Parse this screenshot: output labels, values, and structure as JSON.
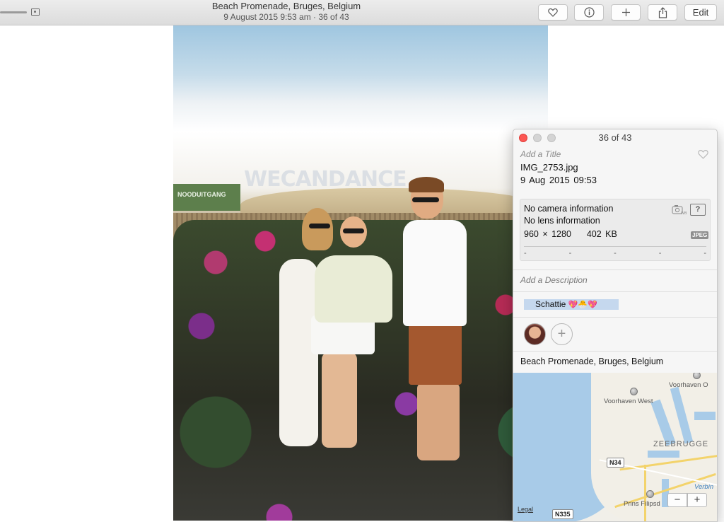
{
  "toolbar": {
    "title": "Beach Promenade, Bruges, Belgium",
    "subtitle": "9 August 2015 9:53 am  ·  36 of 43",
    "edit_label": "Edit",
    "icons": [
      "zoom-slider",
      "photo-size-icon",
      "heart-icon",
      "info-icon",
      "plus-icon",
      "share-icon"
    ]
  },
  "photo": {
    "sign_text": "WECANDANCE",
    "green_sign_text": "NOODUITGANG"
  },
  "info_panel": {
    "window_title": "36 of 43",
    "title_placeholder": "Add a Title",
    "filename": "IMG_2753.jpg",
    "date": "9 Aug 2015   09:53",
    "camera": "No camera information",
    "lens": "No lens information",
    "dimensions": "960 × 1280",
    "size": "402 KB",
    "format_badge": "JPEG",
    "wb_label": "WB",
    "help_label": "?",
    "exif_placeholders": [
      "-",
      "-",
      "-",
      "-",
      "-"
    ],
    "description_placeholder": "Add a Description",
    "keyword": "Schattie",
    "keyword_emoji": "💖🐣💖",
    "add_face_label": "+",
    "location": "Beach Promenade, Bruges, Belgium"
  },
  "map": {
    "labels": {
      "voorhaven_o": "Voorhaven O",
      "voorhaven_west": "Voorhaven West",
      "zeebrugge": "ZEEBRUGGE",
      "verbin": "Verbin",
      "prins": "Prins Filipsd",
      "n34": "N34",
      "n335": "N335",
      "legal": "Legal"
    },
    "zoom_out": "−",
    "zoom_in": "+",
    "colors": {
      "water": "#a8cbe8",
      "land": "#f2efe7",
      "road": "#f3d36b"
    }
  }
}
